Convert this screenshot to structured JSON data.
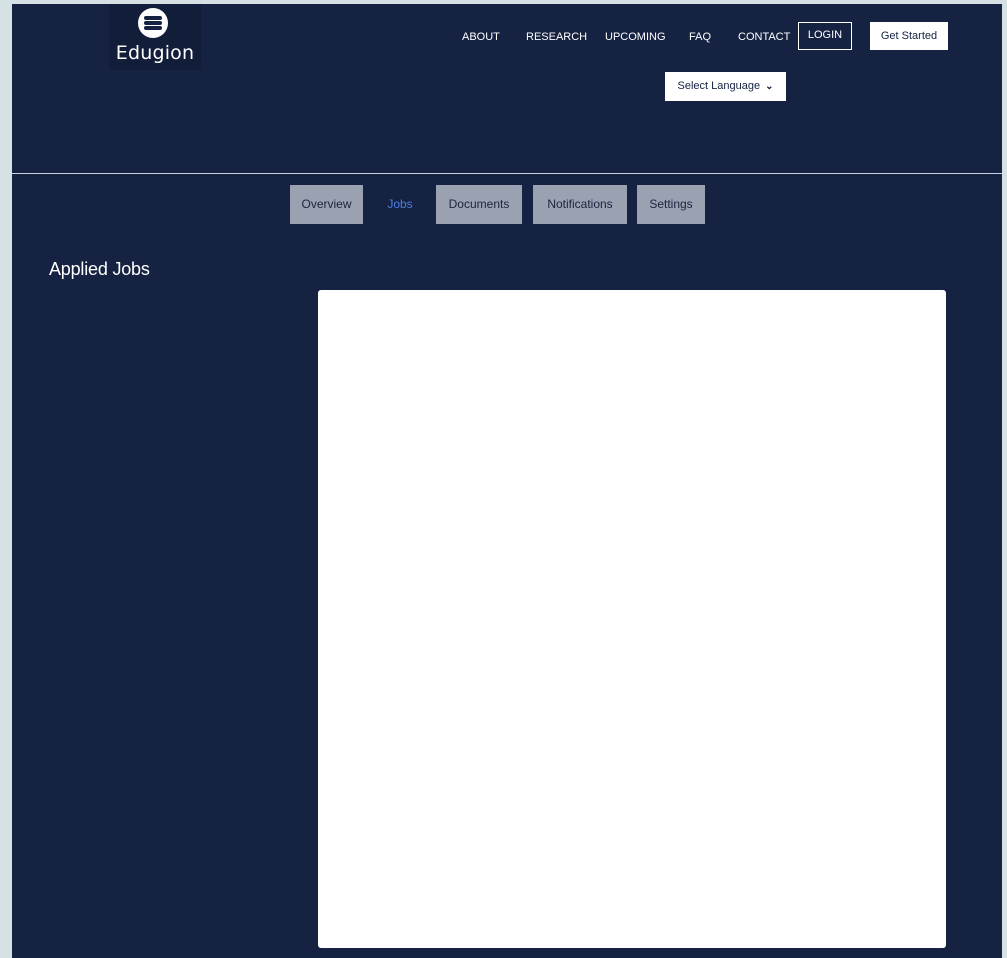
{
  "brand": {
    "name": "Edugion"
  },
  "nav": {
    "about": "ABOUT",
    "research": "RESEARCH",
    "upcoming": "UPCOMING",
    "faq": "FAQ",
    "contact": "CONTACT",
    "login": "LOGIN",
    "get_started": "Get Started"
  },
  "language": {
    "selected": "Select Language",
    "icon": "chevron-down-icon"
  },
  "tabs": [
    {
      "label": "Overview",
      "active": false
    },
    {
      "label": "Jobs",
      "active": true
    },
    {
      "label": "Documents",
      "active": false
    },
    {
      "label": "Notifications",
      "active": false
    },
    {
      "label": "Settings",
      "active": false
    }
  ],
  "main": {
    "title": "Applied Jobs"
  },
  "colors": {
    "background": "#152242",
    "page_backdrop": "#d6e1e6",
    "tab_bg": "#9aa2b1",
    "active_tab_text": "#4a7fe4",
    "panel": "#ffffff"
  }
}
